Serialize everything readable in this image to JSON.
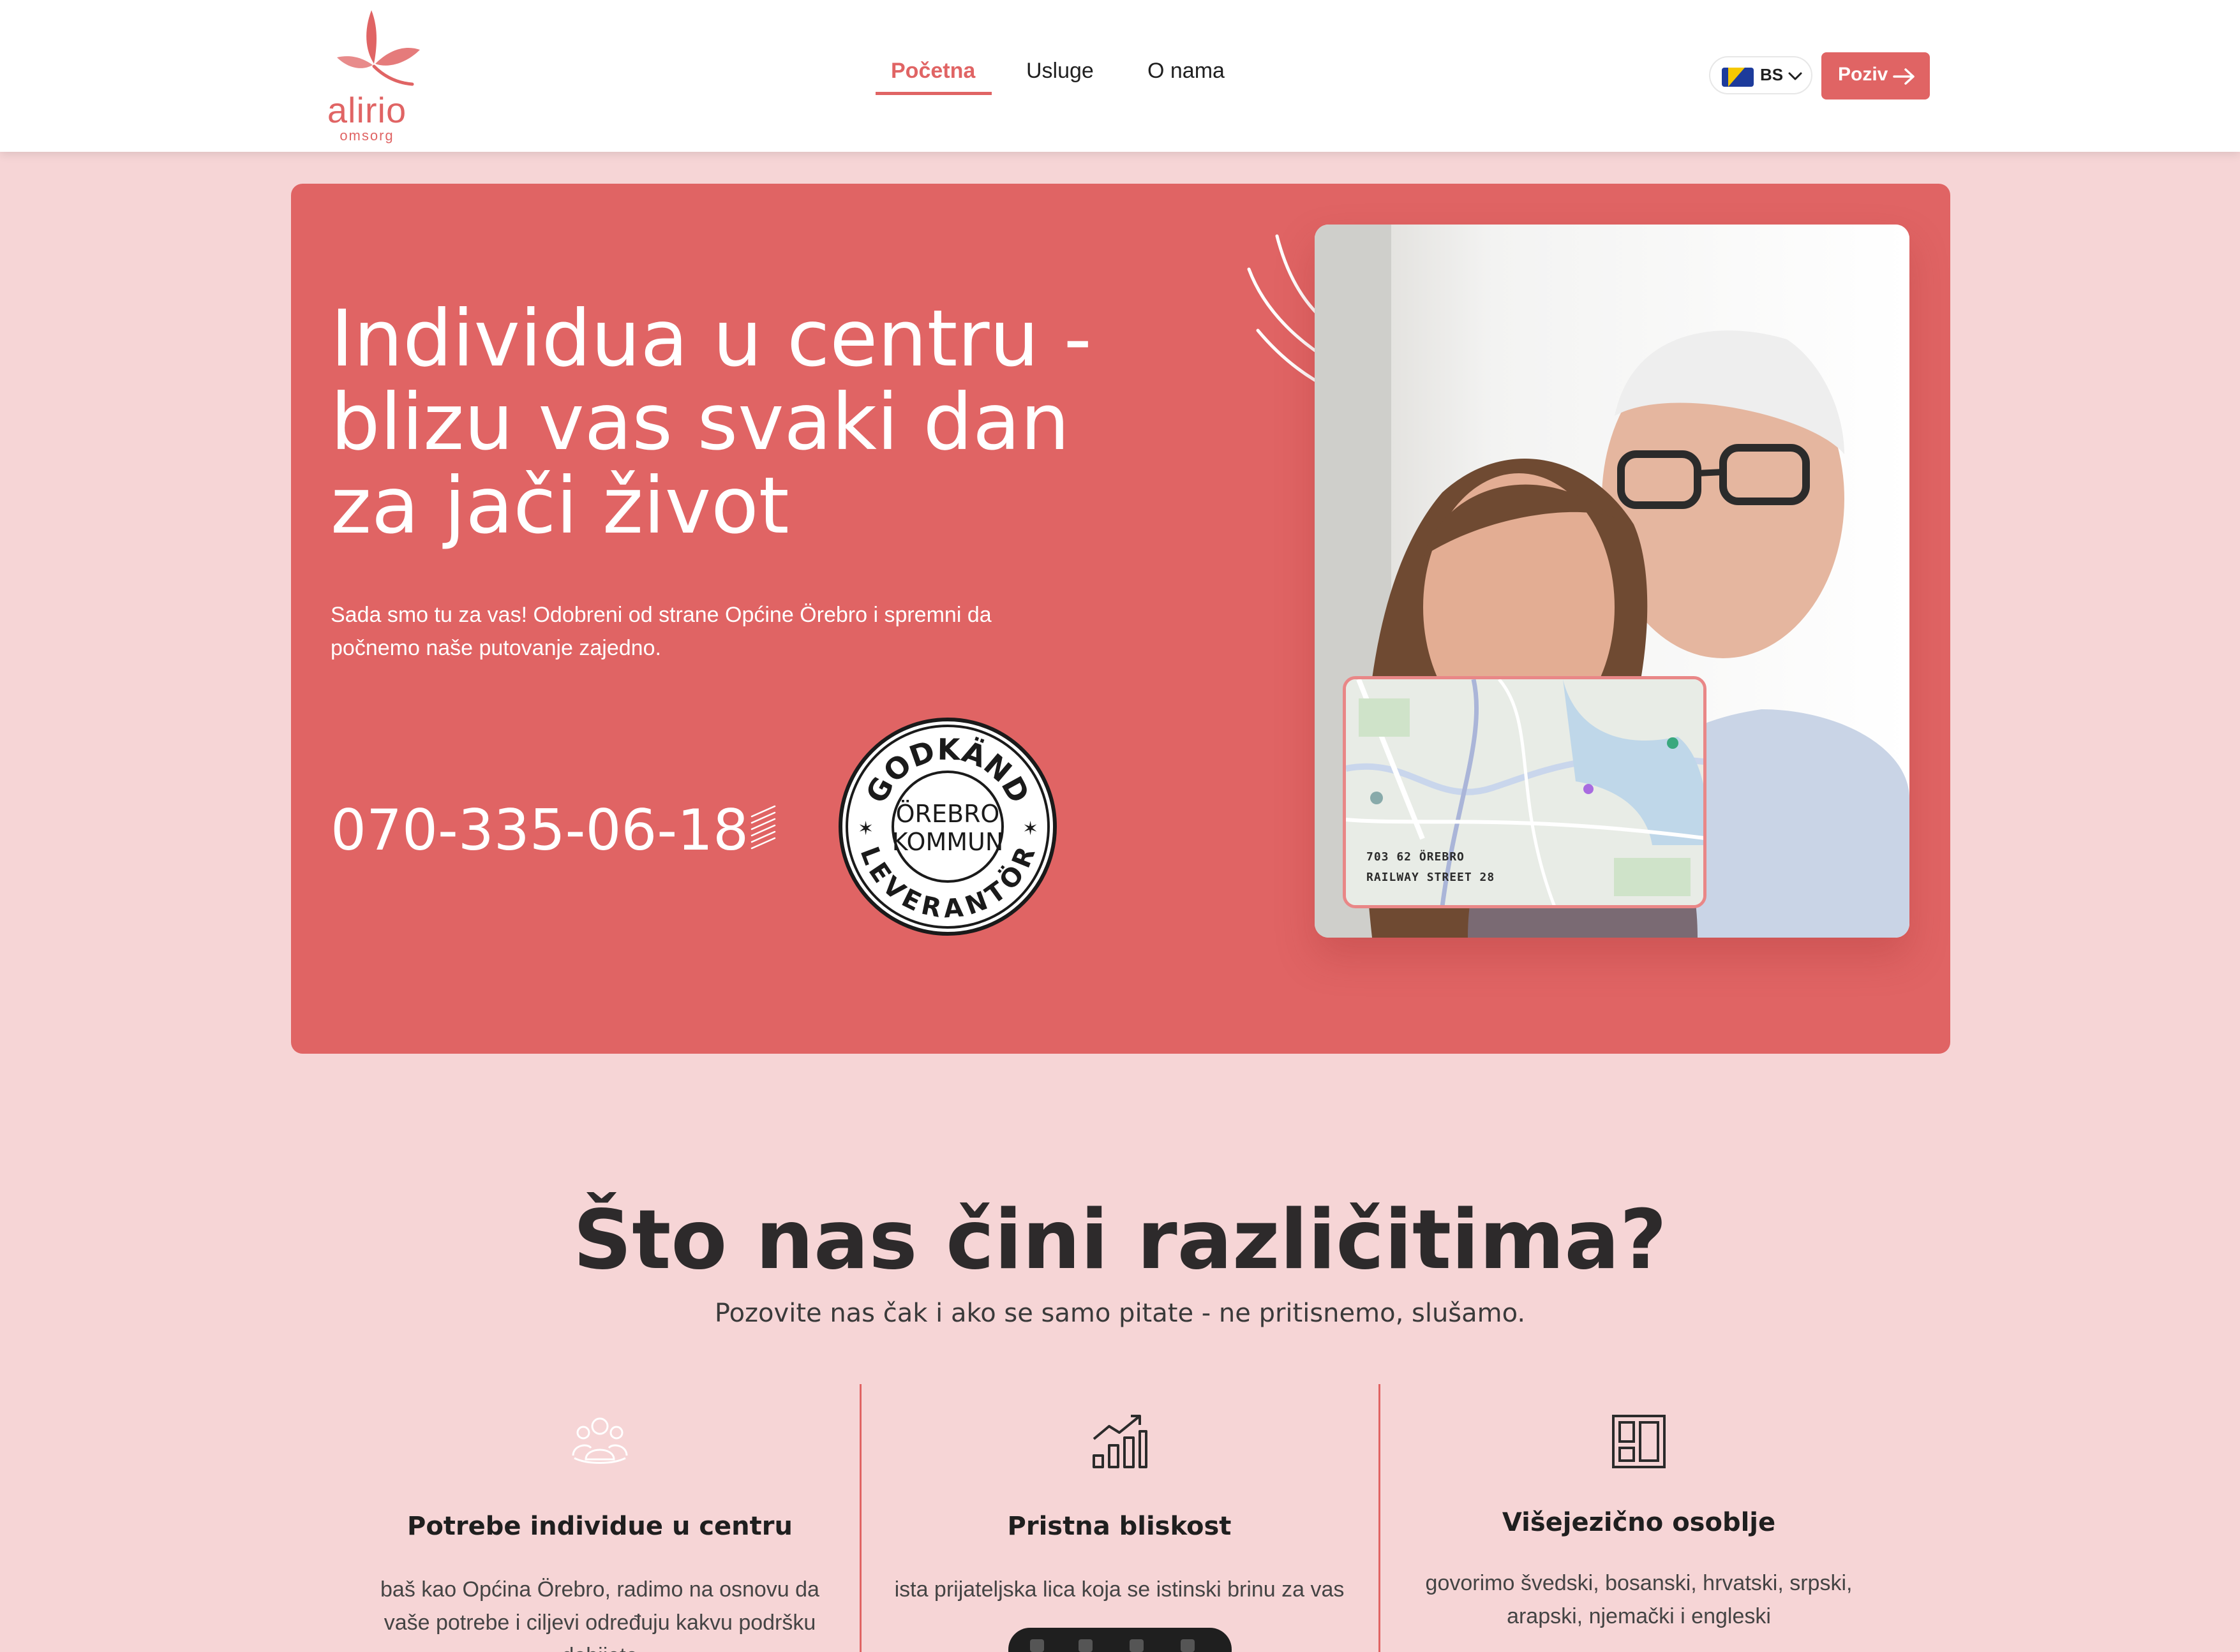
{
  "header": {
    "logo": {
      "name": "alirio",
      "tagline": "omsorg"
    },
    "nav": [
      {
        "label": "Početna",
        "active": true
      },
      {
        "label": "Usluge",
        "active": false
      },
      {
        "label": "O nama",
        "active": false
      }
    ],
    "language": {
      "code": "BS",
      "flag_icon": "bosnia-flag-icon"
    },
    "call_button": {
      "label": "Poziv",
      "icon": "arrow-right-icon"
    }
  },
  "hero": {
    "title": "Individua u centru - blizu vas svaki dan za jači život",
    "subtitle": "Sada smo tu za vas! Odobreni od strane Općine Örebro i spremni da počnemo naše putovanje zajedno.",
    "phone": "070-335-06-18",
    "stamp": {
      "top_text": "GODKÄND",
      "center_line1": "ÖREBRO",
      "center_line2": "KOMMUN",
      "bottom_text": "LEVERANTÖR"
    },
    "map": {
      "address_line1": "703 62 ÖREBRO",
      "address_line2": "RAILWAY STREET 28"
    }
  },
  "features": {
    "title": "Što nas čini različitima?",
    "subtitle": "Pozovite nas čak i ako se samo pitate - ne pritisnemo, slušamo.",
    "items": [
      {
        "icon": "people-group-icon",
        "title": "Potrebe individue u centru",
        "text": "baš kao Općina Örebro, radimo na osnovu da vaše potrebe i ciljevi određuju kakvu podršku dobijete"
      },
      {
        "icon": "growth-chart-icon",
        "title": "Pristna bliskost",
        "text": "ista prijateljska lica koja se istinski brinu za vas"
      },
      {
        "icon": "layout-panels-icon",
        "title": "Višejezično osoblje",
        "text": "govorimo švedski, bosanski, hrvatski, srpski, arapski, njemački i engleski"
      }
    ]
  },
  "colors": {
    "brand": "#e06464",
    "background": "#f6d5d6",
    "text": "#2d2a2b"
  }
}
